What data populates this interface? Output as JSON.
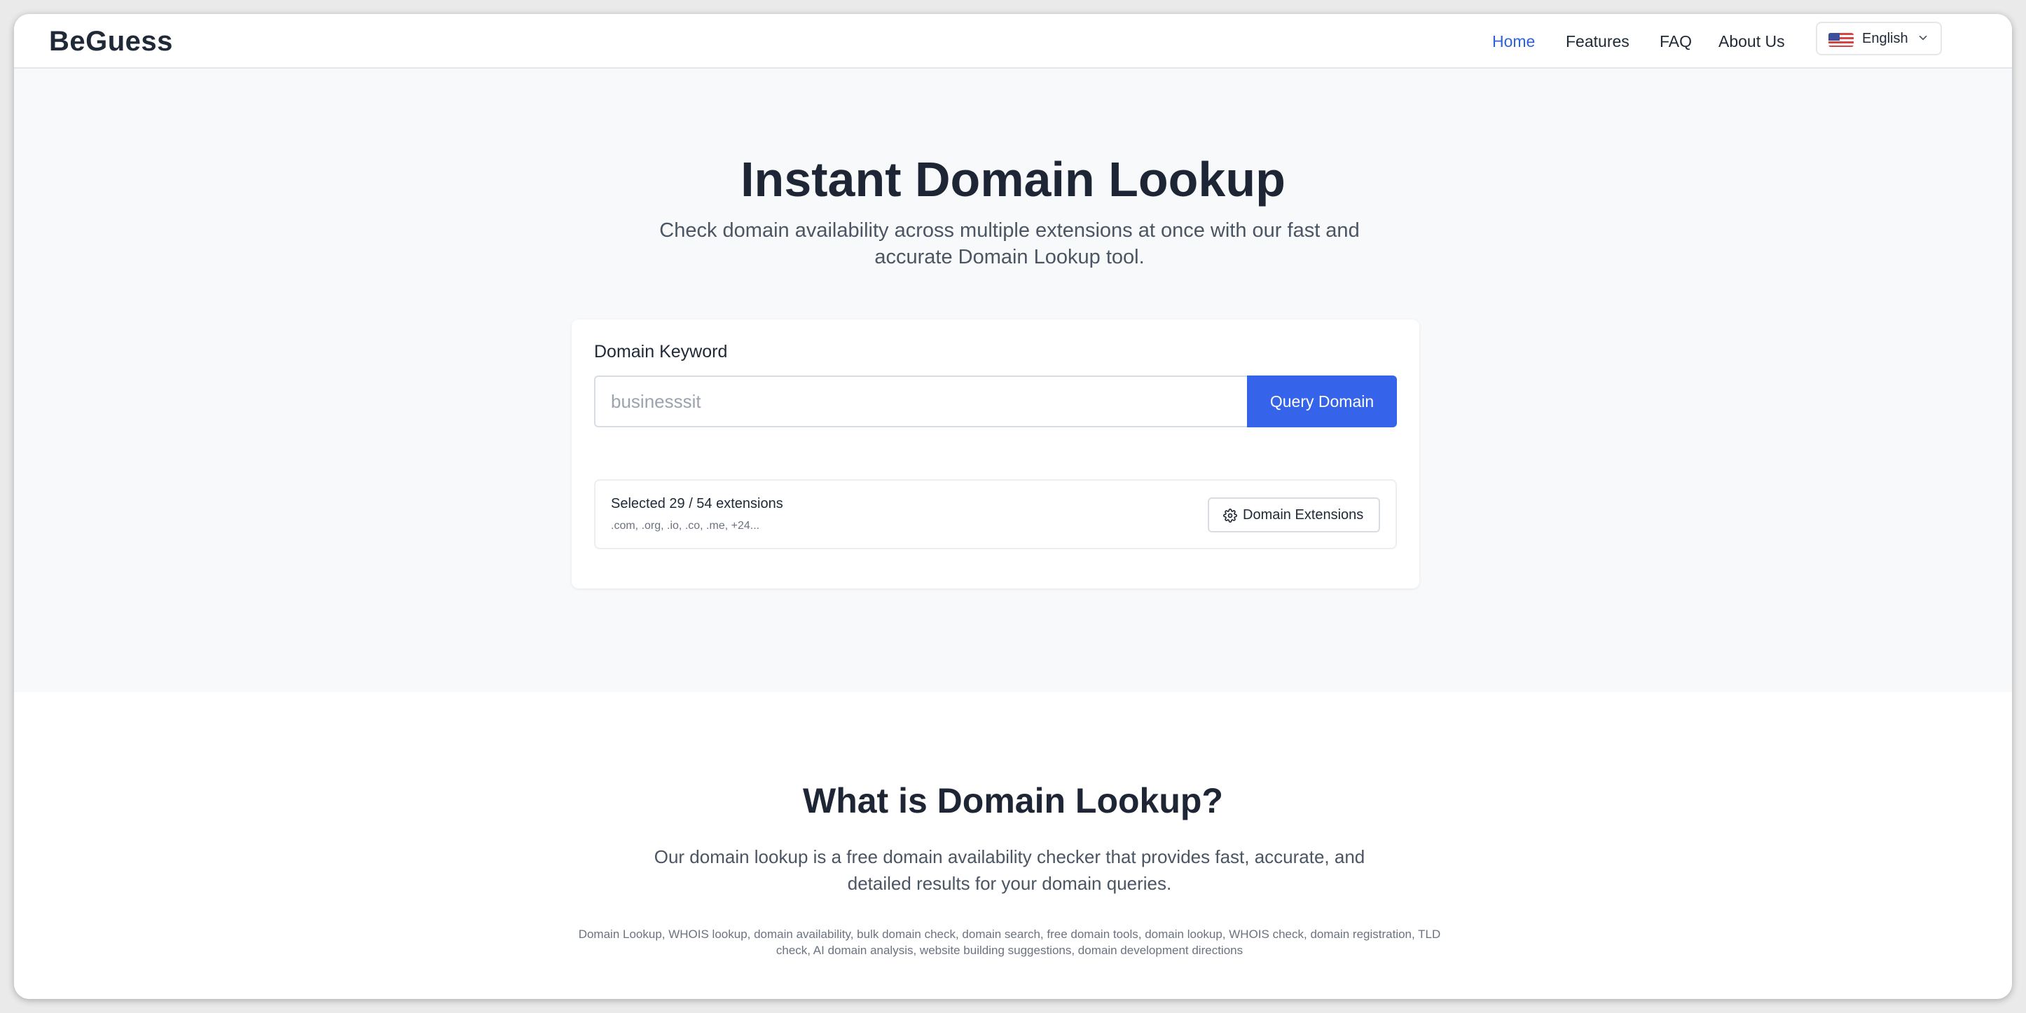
{
  "header": {
    "logo": "BeGuess",
    "nav": [
      {
        "label": "Home",
        "active": true
      },
      {
        "label": "Features",
        "active": false
      },
      {
        "label": "FAQ",
        "active": false
      },
      {
        "label": "About Us",
        "active": false
      }
    ],
    "language": {
      "label": "English",
      "flag_icon": "us-flag-icon"
    }
  },
  "hero": {
    "title": "Instant Domain Lookup",
    "subtitle": "Check domain availability across multiple extensions at once with our fast and accurate Domain Lookup tool."
  },
  "search": {
    "label": "Domain Keyword",
    "input_value": "",
    "placeholder": "businesssit",
    "button": "Query Domain"
  },
  "extensions": {
    "summary": "Selected 29 / 54 extensions",
    "list": ".com, .org, .io, .co, .me, +24...",
    "button": "Domain Extensions"
  },
  "info": {
    "title": "What is Domain Lookup?",
    "subtitle": "Our domain lookup is a free domain availability checker that provides fast, accurate, and detailed results for your domain queries.",
    "keywords": "Domain Lookup, WHOIS lookup, domain availability, bulk domain check, domain search, free domain tools, domain lookup, WHOIS check, domain registration, TLD check, AI domain analysis, website building suggestions, domain development directions"
  },
  "colors": {
    "accent": "#3563e9",
    "active_nav": "#2f5fdc",
    "hero_bg": "#f8f9fb",
    "heading": "#1e2535"
  }
}
